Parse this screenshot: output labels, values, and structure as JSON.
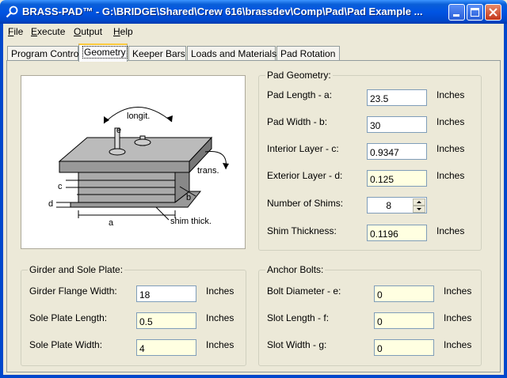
{
  "window": {
    "title": "BRASS-PAD™ - G:\\BRIDGE\\Shared\\Crew 616\\brassdev\\Comp\\Pad\\Pad Example ...",
    "icon": "magnifier-icon"
  },
  "menu": [
    {
      "label": "File"
    },
    {
      "label": "Execute"
    },
    {
      "label": "Output"
    },
    {
      "label": "Help"
    }
  ],
  "tabs": [
    {
      "label": "Program Control"
    },
    {
      "label": "Geometry"
    },
    {
      "label": "Keeper Bars"
    },
    {
      "label": "Loads and Materials"
    },
    {
      "label": "Pad Rotation"
    }
  ],
  "diagram": {
    "longit": "longit.",
    "trans": "trans.",
    "e": "e",
    "c": "c",
    "d": "d",
    "b": "b",
    "a": "a",
    "shim": "shim thick."
  },
  "pad_geometry": {
    "title": "Pad Geometry:",
    "rows": [
      {
        "label": "Pad Length - a:",
        "value": "23.5",
        "unit": "Inches"
      },
      {
        "label": "Pad Width - b:",
        "value": "30",
        "unit": "Inches"
      },
      {
        "label": "Interior Layer - c:",
        "value": "0.9347",
        "unit": "Inches"
      },
      {
        "label": "Exterior Layer - d:",
        "value": "0.125",
        "unit": "Inches"
      },
      {
        "label": "Number of Shims:",
        "value": "8",
        "unit": ""
      },
      {
        "label": "Shim Thickness:",
        "value": "0.1196",
        "unit": "Inches"
      }
    ]
  },
  "girder": {
    "title": "Girder and Sole Plate:",
    "rows": [
      {
        "label": "Girder Flange Width:",
        "value": "18",
        "unit": "Inches"
      },
      {
        "label": "Sole Plate Length:",
        "value": "0.5",
        "unit": "Inches"
      },
      {
        "label": "Sole Plate Width:",
        "value": "4",
        "unit": "Inches"
      }
    ]
  },
  "anchor": {
    "title": "Anchor Bolts:",
    "rows": [
      {
        "label": "Bolt Diameter - e:",
        "value": "0",
        "unit": "Inches"
      },
      {
        "label": "Slot Length - f:",
        "value": "0",
        "unit": "Inches"
      },
      {
        "label": "Slot Width - g:",
        "value": "0",
        "unit": "Inches"
      }
    ]
  }
}
